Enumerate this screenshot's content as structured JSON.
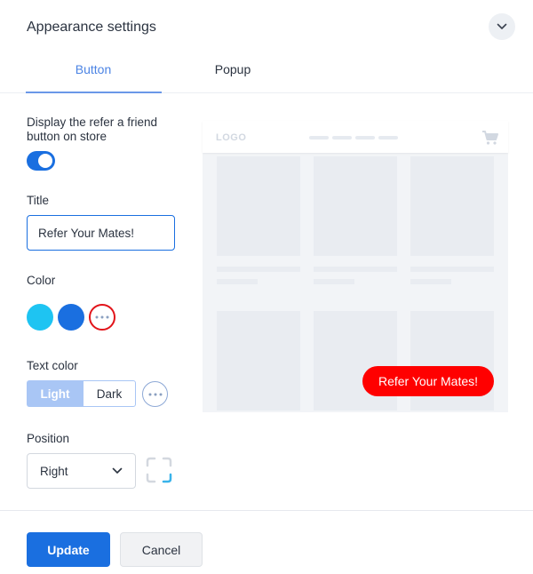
{
  "header": {
    "title": "Appearance settings",
    "collapse_icon": "chevron-down-icon"
  },
  "tabs": [
    {
      "label": "Button",
      "active": true
    },
    {
      "label": "Popup",
      "active": false
    }
  ],
  "display": {
    "label_line1": "Display the refer a friend",
    "label_line2": "button on store",
    "enabled": true
  },
  "title_field": {
    "label": "Title",
    "value": "Refer Your Mates!"
  },
  "color": {
    "label": "Color",
    "swatches": [
      "#1ec4f2",
      "#1a6fe0"
    ],
    "custom_icon": "more-dots-icon",
    "custom_ring_color": "#e2141a"
  },
  "text_color": {
    "label": "Text color",
    "options": [
      "Light",
      "Dark"
    ],
    "selected": "Light",
    "custom_icon": "more-dots-icon"
  },
  "position": {
    "label": "Position",
    "selected": "Right",
    "options": [
      "Right"
    ],
    "corner_icon": "corner-position-icon"
  },
  "footer": {
    "update_label": "Update",
    "cancel_label": "Cancel"
  },
  "preview": {
    "logo": "LOGO",
    "cart_icon": "cart-icon",
    "button_label": "Refer Your Mates!",
    "button_color": "#ff0000",
    "button_text_color": "#ffffff"
  },
  "colors": {
    "accent": "#1a6fe0",
    "accent_light": "#a9c6f5",
    "text": "#2b3340"
  }
}
